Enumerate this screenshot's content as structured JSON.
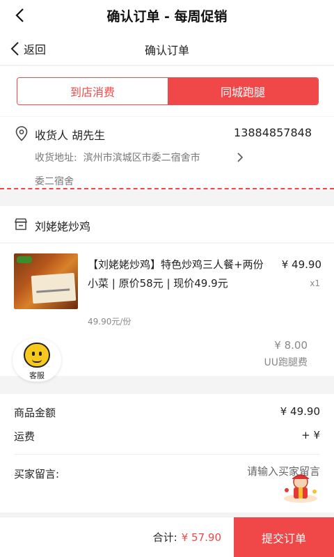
{
  "header": {
    "title": "确认订单 - 每周促销"
  },
  "nav": {
    "back_label": "返回",
    "title": "确认订单"
  },
  "tabs": [
    {
      "label": "到店消费",
      "active": false
    },
    {
      "label": "同城跑腿",
      "active": true
    }
  ],
  "address": {
    "recipient": "收货人 胡先生",
    "phone": "13884857848",
    "label": "收货地址:",
    "line": "滨州市滨城区市委二宿舍市",
    "line_cont": "委二宿舍"
  },
  "shop": {
    "name": "刘姥姥炒鸡"
  },
  "item": {
    "title": "【刘姥姥炒鸡】特色炒鸡三人餐+两份小菜 | 原价58元 | 现价49.9元",
    "unit_price": "49.90元/份",
    "price": "¥ 49.90",
    "qty": "x1"
  },
  "delivery": {
    "fee": "¥ 8.00",
    "label": "UU跑腿费"
  },
  "customer_service": {
    "label": "客服"
  },
  "summary": {
    "goods_label": "商品金额",
    "goods_value": "¥ 49.90",
    "shipping_label": "运费",
    "shipping_value": "+ ¥",
    "note_label": "买家留言:",
    "note_placeholder": "请输入买家留言"
  },
  "footer": {
    "total_label": "合计:",
    "total_value": "¥ 57.90",
    "submit_label": "提交订单"
  },
  "colors": {
    "accent": "#f04848"
  },
  "icons": [
    "back-arrow-icon",
    "location-pin-icon",
    "chevron-right-icon",
    "shop-icon",
    "customer-service-icon",
    "gift-icon"
  ]
}
